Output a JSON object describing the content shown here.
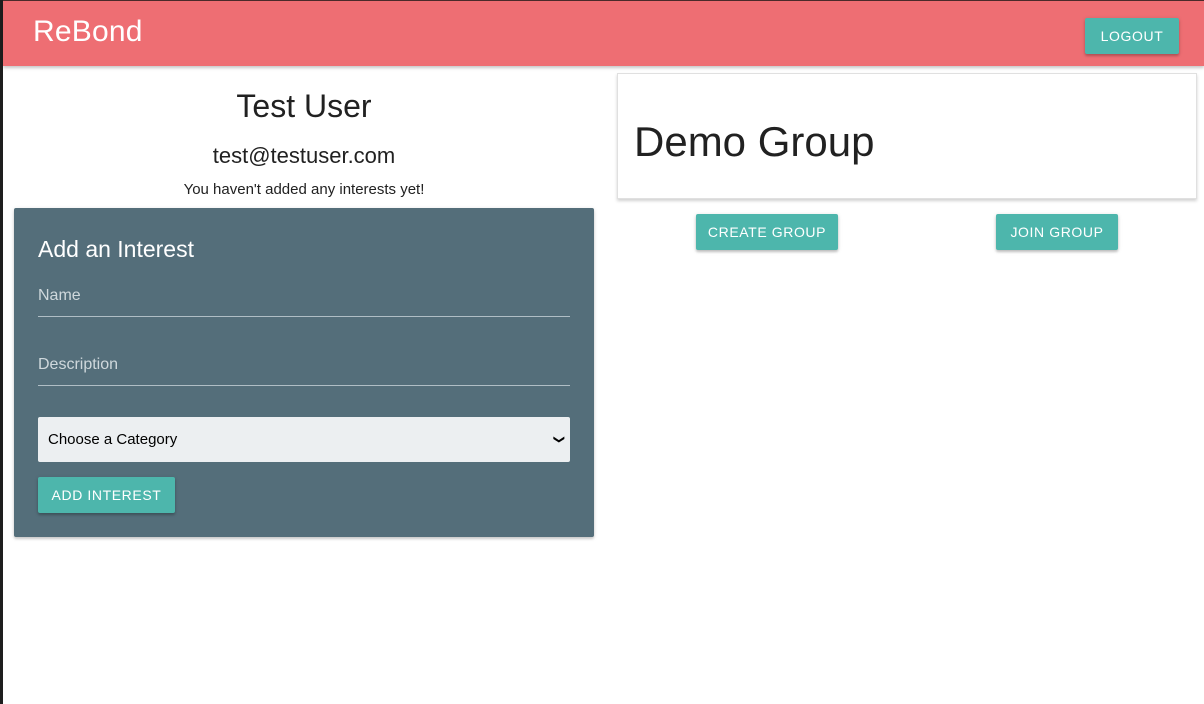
{
  "navbar": {
    "brand": "ReBond",
    "logout_label": "LOGOUT",
    "color": "#ee6e73"
  },
  "profile": {
    "name": "Test User",
    "email": "test@testuser.com",
    "no_interests_message": "You haven't added any interests yet!"
  },
  "interest_form": {
    "title": "Add an Interest",
    "name_placeholder": "Name",
    "name_value": "",
    "description_placeholder": "Description",
    "description_value": "",
    "category_selected": "Choose a Category",
    "submit_label": "ADD INTEREST",
    "card_color": "#546e7a"
  },
  "groups": {
    "current_group": "Demo Group",
    "create_label": "CREATE GROUP",
    "join_label": "JOIN GROUP"
  },
  "colors": {
    "button": "#4db6ac"
  }
}
